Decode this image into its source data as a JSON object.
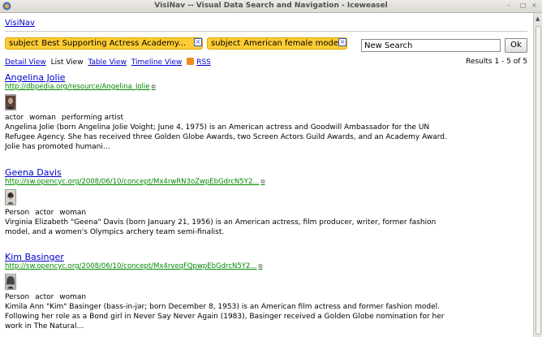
{
  "window": {
    "title": "VisiNav -- Visual Data Search and Navigation - Iceweasel",
    "minimize": "–",
    "maximize": "□",
    "close": "×"
  },
  "nav": {
    "home_link": "VisiNav"
  },
  "facets": [
    {
      "key": "subject",
      "value": "Best Supporting Actress Academy..."
    },
    {
      "key": "subject",
      "value": "American female models"
    }
  ],
  "search": {
    "value": "New Search",
    "button": "Ok"
  },
  "views": {
    "detail": "Detail View",
    "list": "List View",
    "table": "Table View",
    "timeline": "Timeline View",
    "rss": "RSS"
  },
  "results_count": "Results 1 - 5 of 5",
  "results": [
    {
      "name": "Angelina Jolie",
      "uri": "http://dbpedia.org/resource/Angelina_Jolie",
      "types": [
        "actor",
        "woman",
        "performing artist"
      ],
      "description": "Angelina Jolie (born Angelina Jolie Voight; June 4, 1975) is an American actress and Goodwill Ambassador for the UN Refugee Agency. She has received three Golden Globe Awards, two Screen Actors Guild Awards, and an Academy Award. Jolie has promoted humani..."
    },
    {
      "name": "Geena Davis",
      "uri": "http://sw.opencyc.org/2008/06/10/concept/Mx4rwRN3oZwpEbGdrcN5Y2...",
      "types": [
        "Person",
        "actor",
        "woman"
      ],
      "description": "Virginia Elizabeth \"Geena\" Davis (born January 21, 1956) is an American actress, film producer, writer, former fashion model, and a women's Olympics archery team semi-finalist."
    },
    {
      "name": "Kim Basinger",
      "uri": "http://sw.opencyc.org/2008/06/10/concept/Mx4rveqFQpwpEbGdrcN5Y2...",
      "types": [
        "Person",
        "actor",
        "woman"
      ],
      "description": "Kimila Ann \"Kim\" Basinger (bass-in-jər; born December 8, 1953) is an American film actress and former fashion model. Following her role as a Bond girl in Never Say Never Again (1983), Basinger received a Golden Globe nomination for her work in The Natural..."
    }
  ],
  "icons": {
    "external_link": "⧉",
    "remove_facet": "×",
    "scroll_up": "▲"
  },
  "colors": {
    "facet_bg": "#ffcc33",
    "link": "#0000cc",
    "uri": "#008800",
    "rss": "#f38b1b"
  }
}
